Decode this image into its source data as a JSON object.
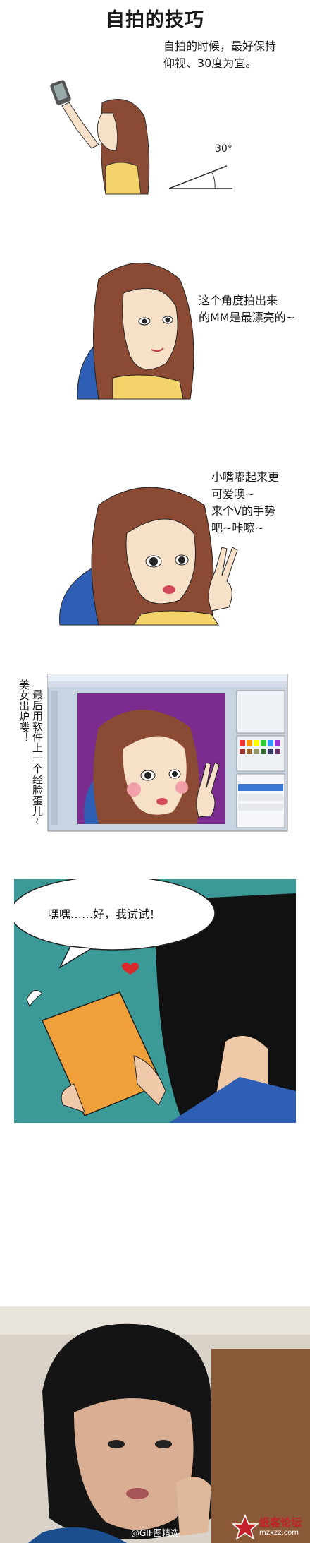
{
  "title": "自拍的技巧",
  "panel1": {
    "caption_line1": "自拍的时候，最好保持",
    "caption_line2": "仰视、30度为宜。",
    "angle_label": "30°"
  },
  "panel2": {
    "caption_line1": "这个角度拍出来",
    "caption_line2": "的MM是最漂亮的~"
  },
  "panel3": {
    "caption_line1": "小嘴嘟起来更",
    "caption_line2": "可爱噢~",
    "caption_line3": "来个V的手势",
    "caption_line4": "吧~咔嚓~"
  },
  "panel4": {
    "vertical_col1": "最后用软件上一个经脸蛋儿~",
    "vertical_col2": "美女出炉喽！"
  },
  "panel5": {
    "bubble_text": "嘿嘿……好，我试试！"
  },
  "footer": {
    "weibo_text": "@GIF图精选",
    "logo_text": "纸客论坛",
    "logo_url": "mzxzz.com"
  },
  "colors": {
    "hair": "#8a4a34",
    "skin": "#f7e0c8",
    "chair": "#2f5fb5",
    "teal": "#3b9a98",
    "book": "#f0a03a",
    "purple": "#7b2d8f",
    "ps_bg": "#c9d4e2"
  }
}
